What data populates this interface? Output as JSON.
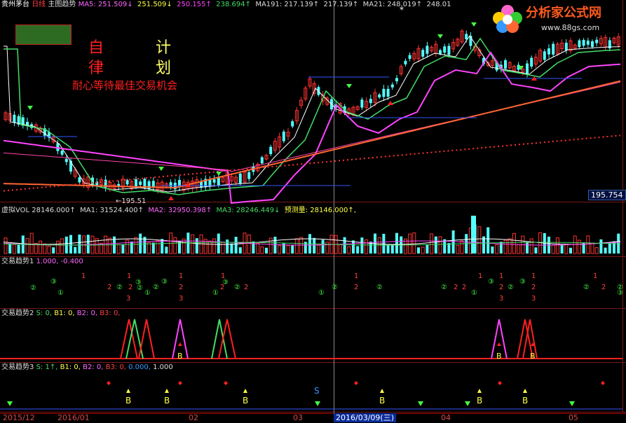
{
  "header": {
    "stock": "贵州茅台",
    "period": "日线",
    "indicator": "主图趋势",
    "ma5": "MA5: 251.509↓",
    "ma5b": "251.509↓",
    "ma5c": "250.155↑",
    "ma5d": "238.694↑",
    "ma191": "MA191: 217.139↑",
    "ma191b": "217.139↑",
    "ma21": "MA21: 248.019↑",
    "ma21b": "248.01"
  },
  "logo": {
    "text": "分析家公式网",
    "url": "www.88gs.com"
  },
  "slogan": {
    "c1": "自",
    "c2": "计",
    "c3": "律",
    "c4": "划",
    "line": "耐心等待最佳交易机会"
  },
  "price": {
    "low_label": "195.51",
    "right_box": "195.754"
  },
  "vol_header": {
    "name": "虚拟VOL",
    "v": "28146.000↑",
    "ma1": "MA1: 31524.400↑",
    "ma2": "MA2: 32950.398↑",
    "ma3": "MA3: 28246.449↓",
    "pred": "预测量: 28146.000↑,"
  },
  "panel1": {
    "name": "交易趋势1",
    "values": "1.000, -0.400"
  },
  "panel2": {
    "name": "交易趋势2",
    "s": "S: 0,",
    "b1": "B1: 0,",
    "b2": "B2: 0,",
    "b3": "B3: 0,"
  },
  "panel3": {
    "name": "交易趋势3",
    "s": "S: 1↑,",
    "b1": "B1: 0,",
    "b2": "B2: 0,",
    "b3": "B3: 0,",
    "v": "0.000,",
    "w": "1.000"
  },
  "dates": [
    "2015/12",
    "2016/01",
    "02",
    "03",
    "04",
    "05"
  ],
  "cursor_date": "2016/03/09(三)",
  "signals": {
    "buy": "B",
    "sell": "S"
  },
  "colors": {
    "up": "#ff3232",
    "down": "#54ffff",
    "ma_pink": "#ff44ff",
    "ma_green": "#44dd66",
    "ma_orange": "#ff6633"
  }
}
